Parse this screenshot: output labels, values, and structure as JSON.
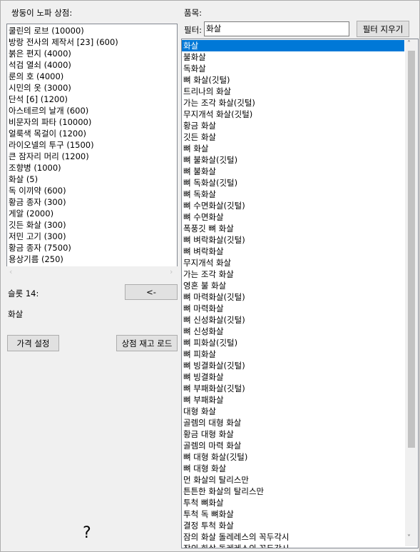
{
  "left_panel": {
    "title": "쌍둥이 노파 상점:",
    "items": [
      "쿨린의 로브 (10000)",
      "방랑 전사의 제작서 [23] (600)",
      "붉은 편지 (4000)",
      "석검 열쇠 (4000)",
      "룬의 호 (4000)",
      "시민의 옷 (3000)",
      "단석 [6] (1200)",
      "아스테르의 날개 (600)",
      "비문자의 파타 (10000)",
      "얼룩색 목걸이 (1200)",
      "라이오넬의 투구 (1500)",
      "큰 잠자리 머리 (1200)",
      "조향병 (1000)",
      "화살 (5)",
      "독 이끼약 (600)",
      "황금 종자 (300)",
      "게알 (2000)",
      "깃든 화살 (300)",
      "저민 고기 (300)",
      "황금 종자 (7500)",
      "용상기름 (250)"
    ],
    "scroll_left": "‹",
    "scroll_right": "›",
    "slot_label": "슬롯 14:",
    "back_button": "<-",
    "slot_value": "화살",
    "set_price_button": "가격 설정",
    "load_stock_button": "상점 재고 로드",
    "bottom_glyph": "?"
  },
  "right_panel": {
    "title": "품목:",
    "filter_label": "필터:",
    "filter_value": "화살",
    "clear_filter_button": "필터 지우기",
    "items": [
      "화살",
      "불화살",
      "독화살",
      "뼈 화살(깃털)",
      "트리나의 화살",
      "가는 조각 화살(깃털)",
      "무지개석 화살(깃털)",
      "황금 화살",
      "깃든 화살",
      "뼈 화살",
      "뼈 불화살(깃털)",
      "뼈 불화살",
      "뼈 독화살(깃털)",
      "뼈 독화살",
      "뼈 수면화살(깃털)",
      "뼈 수면화살",
      "폭풍깃 뼈 화살",
      "뼈 벼락화살(깃털)",
      "뼈 벼락화살",
      "무지개석 화살",
      "가는 조각 화살",
      "영혼 불 화살",
      "뼈 마력화살(깃털)",
      "뼈 마력화살",
      "뼈 신성화살(깃털)",
      "뼈 신성화살",
      "뼈 피화살(깃털)",
      "뼈 피화살",
      "뼈 빙결화살(깃털)",
      "뼈 빙결화살",
      "뼈 부패화살(깃털)",
      "뼈 부패화살",
      "대형 화살",
      "골렘의 대형 화살",
      "황금 대형 화살",
      "골렘의 마력 화살",
      "뼈 대형 화살(깃털)",
      "뼈 대형 화살",
      "먼 화살의 탈리스만",
      "튼튼한 화살의 탈리스만",
      "투척 뼈화살",
      "투척 독 뼈화살",
      "결정 투척 화살",
      "잠의 화살 돌레레스의 꼭두각시",
      "잠의 화살 돌레레스의 꼭두각시"
    ],
    "selected_index": 0,
    "scroll_up": "˄",
    "scroll_down": "˅"
  }
}
